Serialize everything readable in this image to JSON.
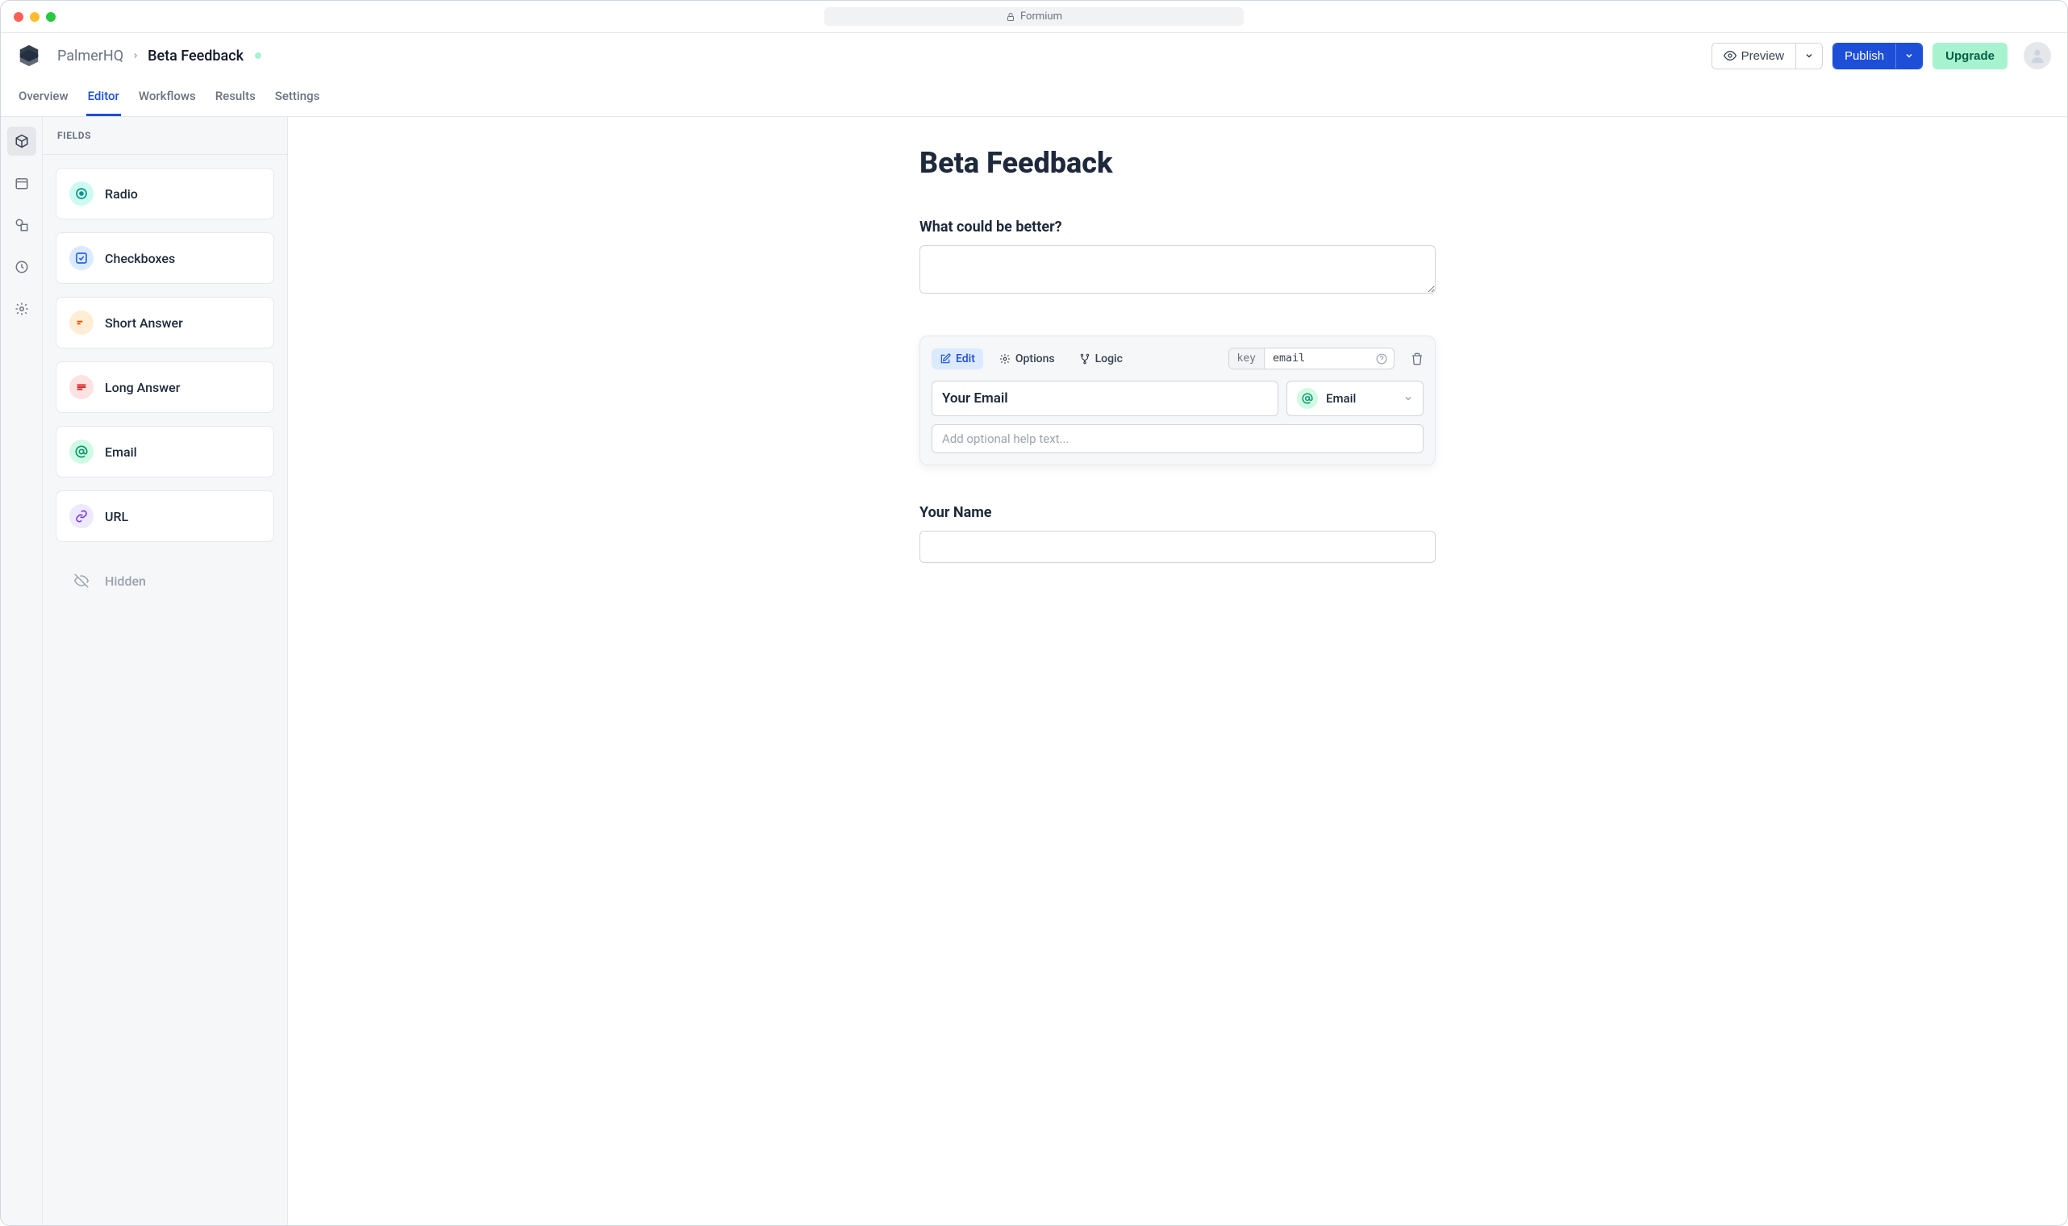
{
  "browser": {
    "title": "Formium"
  },
  "breadcrumb": {
    "org": "PalmerHQ",
    "project": "Beta Feedback"
  },
  "header": {
    "preview": "Preview",
    "publish": "Publish",
    "upgrade": "Upgrade"
  },
  "tabs": [
    {
      "label": "Overview",
      "active": false
    },
    {
      "label": "Editor",
      "active": true
    },
    {
      "label": "Workflows",
      "active": false
    },
    {
      "label": "Results",
      "active": false
    },
    {
      "label": "Settings",
      "active": false
    }
  ],
  "sidebar": {
    "title": "FIELDS",
    "fields": [
      {
        "label": "Radio",
        "icon": "radio",
        "bg": "#ccfbf1",
        "fg": "#0d9488"
      },
      {
        "label": "Checkboxes",
        "icon": "checkbox",
        "bg": "#dbeafe",
        "fg": "#2563eb"
      },
      {
        "label": "Short Answer",
        "icon": "short",
        "bg": "#ffedd5",
        "fg": "#ea580c"
      },
      {
        "label": "Long Answer",
        "icon": "long",
        "bg": "#fee2e2",
        "fg": "#dc2626"
      },
      {
        "label": "Email",
        "icon": "email",
        "bg": "#d1fae5",
        "fg": "#059669"
      },
      {
        "label": "URL",
        "icon": "url",
        "bg": "#ede9fe",
        "fg": "#7c3aed"
      },
      {
        "label": "Hidden",
        "icon": "hidden",
        "bg": "transparent",
        "fg": "#9ca3af",
        "disabled": true
      }
    ]
  },
  "form": {
    "title": "Beta Feedback",
    "q1_label": "What could be better?",
    "q3_label": "Your Name"
  },
  "editor_card": {
    "edit": "Edit",
    "options": "Options",
    "logic": "Logic",
    "key_label": "key",
    "key_value": "email",
    "title_value": "Your Email",
    "type_label": "Email",
    "help_placeholder": "Add optional help text..."
  }
}
